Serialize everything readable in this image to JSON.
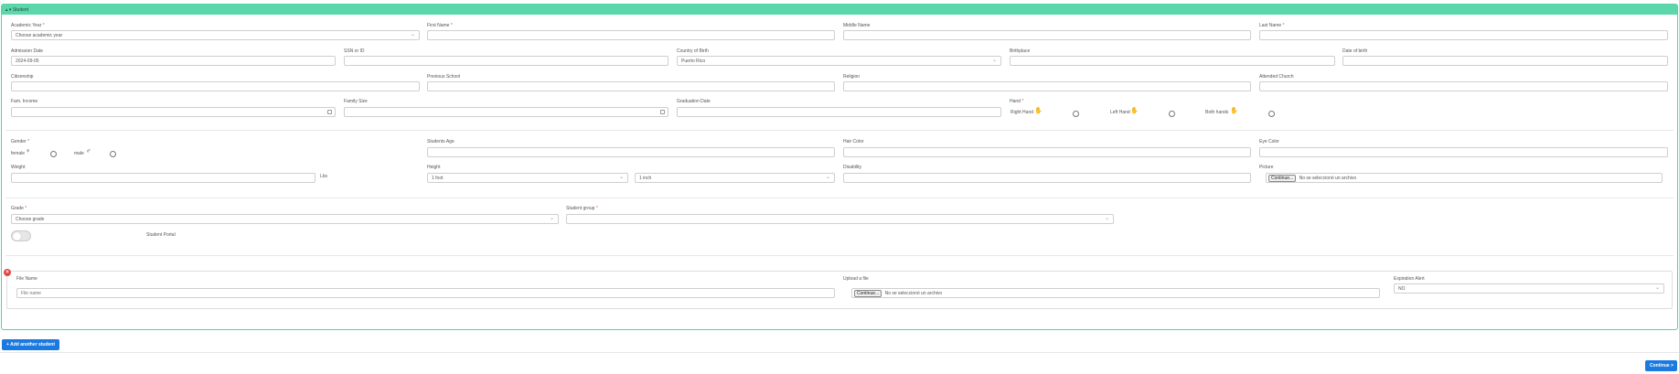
{
  "panel": {
    "title": "Student",
    "toggle_glyph": "▴ ▾"
  },
  "fields": {
    "academic_year": {
      "label": "Academic Year",
      "value": "Choose academic year"
    },
    "first_name": {
      "label": "First Name",
      "value": ""
    },
    "middle_name": {
      "label": "Middle Name",
      "value": ""
    },
    "last_name": {
      "label": "Last Name",
      "value": ""
    },
    "admission_date": {
      "label": "Admission Date",
      "value": "2024-09-05"
    },
    "ssn": {
      "label": "SSN or ID",
      "value": ""
    },
    "country_of_birth": {
      "label": "Country of Birth",
      "value": "Puerto Rico"
    },
    "birthplace": {
      "label": "Birthplace",
      "value": ""
    },
    "date_of_birth": {
      "label": "Date of birth",
      "value": ""
    },
    "citizenship": {
      "label": "Citizenship",
      "value": ""
    },
    "previous_school": {
      "label": "Previous School",
      "value": ""
    },
    "religion": {
      "label": "Religion",
      "value": ""
    },
    "attended_church": {
      "label": "Attended Church",
      "value": ""
    },
    "fam_income": {
      "label": "Fam. Income",
      "value": ""
    },
    "family_size": {
      "label": "Family Size",
      "value": ""
    },
    "graduation_date": {
      "label": "Graduation Date",
      "value": ""
    },
    "hand": {
      "label": "Hand",
      "right": "Right Hand",
      "left": "Left Hand",
      "both": "Both hands"
    },
    "gender": {
      "label": "Gender",
      "female": "female",
      "male": "male"
    },
    "students_age": {
      "label": "Students Age",
      "value": ""
    },
    "hair_color": {
      "label": "Hair Color",
      "value": ""
    },
    "eye_color": {
      "label": "Eye Color",
      "value": ""
    },
    "weight": {
      "label": "Weight",
      "value": "",
      "unit": "Lbs"
    },
    "height": {
      "label": "Height",
      "feet": "1 foot",
      "inches": "1 inch"
    },
    "disability": {
      "label": "Disability",
      "value": ""
    },
    "picture": {
      "label": "Picture",
      "button": "Continue...",
      "status": "No se seleccionó un archivo"
    },
    "grade": {
      "label": "Grade",
      "value": "Choose grade"
    },
    "student_group": {
      "label": "Student group",
      "value": ""
    },
    "student_portal": {
      "label": "Student Portal"
    }
  },
  "document": {
    "file_name_label": "File Name",
    "file_name_placeholder": "File name",
    "upload_label": "Upload a file",
    "upload_button": "Continue...",
    "upload_status": "No se seleccionó un archivo",
    "expiration_label": "Expiration Alert",
    "expiration_value": "NO",
    "remove_glyph": "×"
  },
  "actions": {
    "add_student": "+ Add another student",
    "continue": "Continue >"
  },
  "required_mark": "*",
  "colors": {
    "accent": "#5cd6ab",
    "primary": "#1a7ae0",
    "danger": "#e04848"
  }
}
